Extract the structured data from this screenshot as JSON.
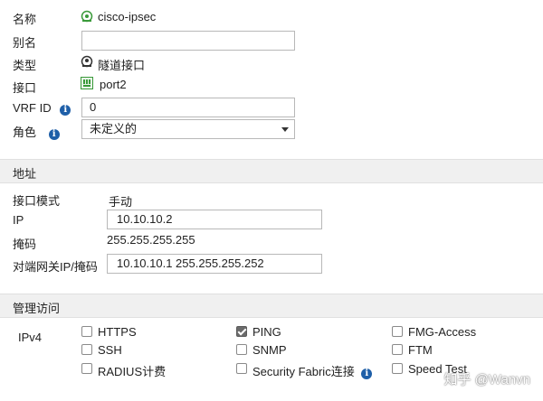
{
  "fields": {
    "name_label": "名称",
    "name_value": "cisco-ipsec",
    "alias_label": "别名",
    "alias_value": "",
    "type_label": "类型",
    "type_value": "隧道接口",
    "interface_label": "接口",
    "interface_value": "port2",
    "vrf_label": "VRF ID",
    "vrf_value": "0",
    "role_label": "角色",
    "role_value": "未定义的"
  },
  "address": {
    "section_title": "地址",
    "mode_label": "接口模式",
    "mode_value": "手动",
    "ip_label": "IP",
    "ip_value": "10.10.10.2",
    "mask_label": "掩码",
    "mask_value": "255.255.255.255",
    "remote_label": "对端网关IP/掩码",
    "remote_value": "10.10.10.1 255.255.255.252"
  },
  "access": {
    "section_title": "管理访问",
    "ipv4_label": "IPv4",
    "options": [
      {
        "label": "HTTPS",
        "checked": false
      },
      {
        "label": "PING",
        "checked": true
      },
      {
        "label": "FMG-Access",
        "checked": false
      },
      {
        "label": "SSH",
        "checked": false
      },
      {
        "label": "SNMP",
        "checked": false
      },
      {
        "label": "FTM",
        "checked": false
      },
      {
        "label": "RADIUS计费",
        "checked": false
      },
      {
        "label": "Security Fabric连接",
        "checked": false
      },
      {
        "label": "Speed Test",
        "checked": false
      }
    ]
  },
  "watermark": "知乎 @Wanvn",
  "colors": {
    "info_icon": "#1e5fa8",
    "section_bg": "#f0f0f0",
    "interface_icon": "#3a9a3a"
  }
}
